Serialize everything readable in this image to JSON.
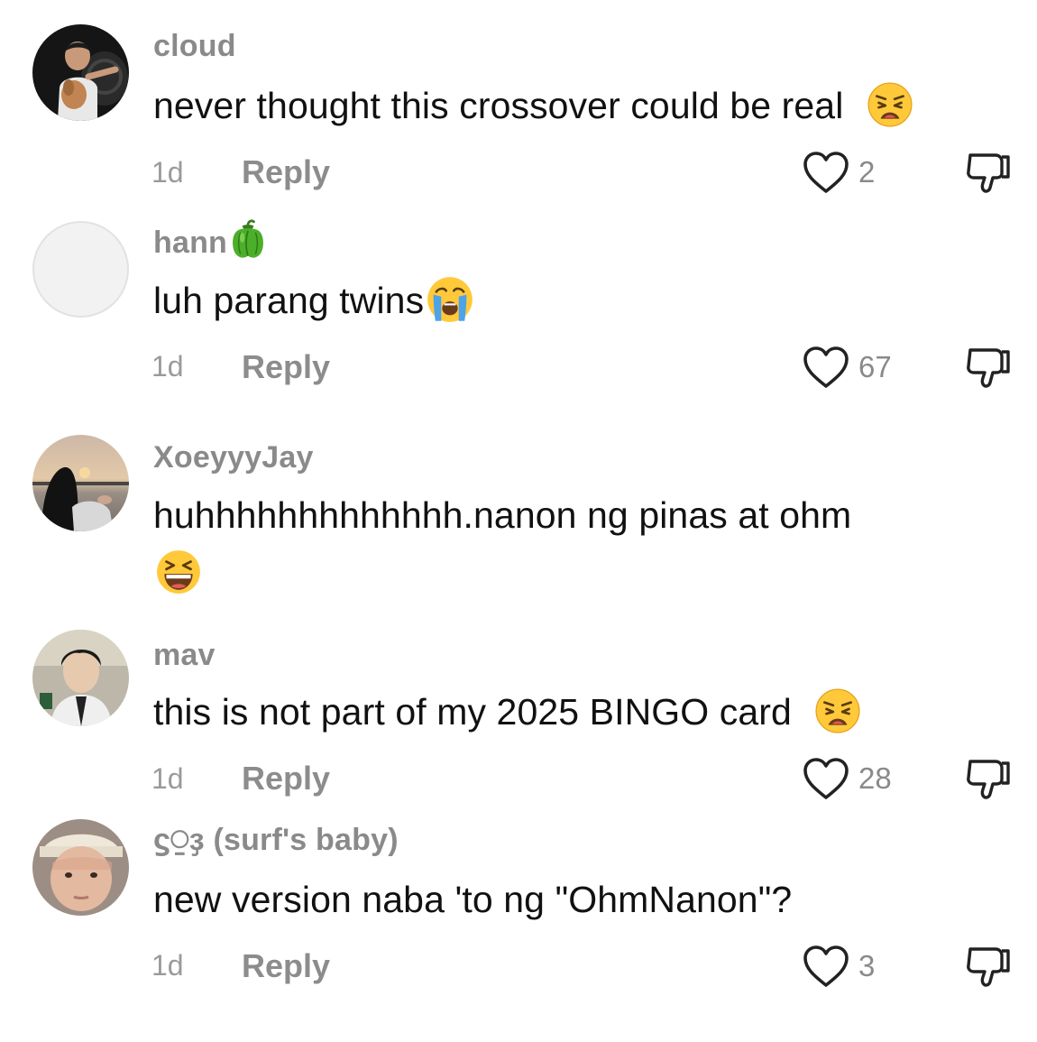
{
  "comments": [
    {
      "username": "cloud",
      "text": "never thought this crossover could be real",
      "emoji_icon": "weary-face",
      "time": "1d",
      "reply_label": "Reply",
      "likes": "2"
    },
    {
      "username": "hann",
      "username_emoji_icon": "bell-pepper",
      "text": "luh parang twins",
      "emoji_icon": "loudly-crying-face",
      "time": "1d",
      "reply_label": "Reply",
      "likes": "67"
    },
    {
      "username": "XoeyyyJay",
      "text": "huhhhhhhhhhhhhh.nanon ng pinas at ohm",
      "emoji_icon": "grinning-squinting-face"
    },
    {
      "username": "mav",
      "text": "this is not part of my 2025 BINGO card",
      "emoji_icon": "weary-face",
      "time": "1d",
      "reply_label": "Reply",
      "likes": "28"
    },
    {
      "username": "ϛ⍜ҙ (surf's baby)",
      "text": "new version naba 'to ng \"OhmNanon\"?",
      "time": "1d",
      "reply_label": "Reply",
      "likes": "3"
    }
  ],
  "colors": {
    "username": "#8a8a8a",
    "text": "#111111",
    "meta": "#9a9a9a"
  }
}
